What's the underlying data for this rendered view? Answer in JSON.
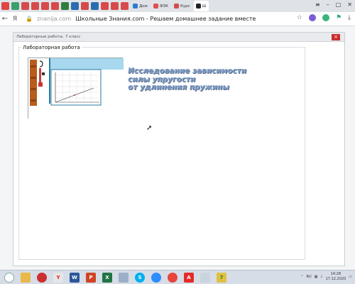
{
  "browser": {
    "tabs": [
      {
        "label": "Дом",
        "color": "#2b7bd3"
      },
      {
        "label": "ФЗК",
        "color": "#e24d4d"
      },
      {
        "label": "Курс",
        "color": "#d44c4c"
      },
      {
        "label": "Ш",
        "color": "#222222",
        "active": true
      }
    ],
    "address": {
      "domain": "znanija.com",
      "page_title": "Школьные Знания.com - Решаем домашнее задание вместе"
    }
  },
  "app": {
    "window_title": "Лабораторные работы. 7 класс",
    "close_label": "×",
    "lab_heading": "Лабораторная работа",
    "title_lines": [
      "Исследование зависимости",
      "силы упругости",
      "от удлинения пружины"
    ]
  },
  "taskbar": {
    "lang": "RU",
    "time": "14:28",
    "date": "17.12.2020"
  }
}
